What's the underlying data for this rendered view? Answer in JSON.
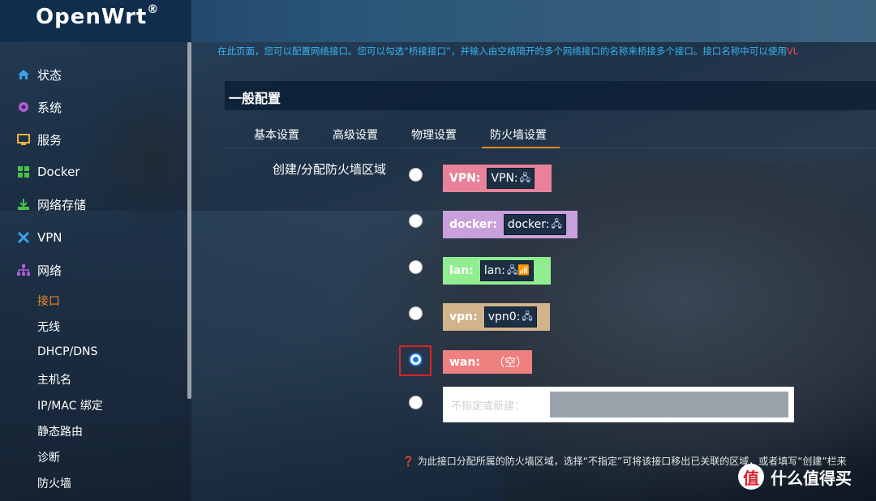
{
  "app": {
    "brand": "OpenWrt",
    "brand_mark": "®"
  },
  "sidebar": {
    "items": [
      {
        "label": "状态",
        "icon": "home-icon",
        "color": "#3aa0e8"
      },
      {
        "label": "系统",
        "icon": "gear-icon",
        "color": "#b25ad8"
      },
      {
        "label": "服务",
        "icon": "services-icon",
        "color": "#e8b43a"
      },
      {
        "label": "Docker",
        "icon": "docker-icon",
        "color": "#4cc04c"
      },
      {
        "label": "网络存储",
        "icon": "storage-icon",
        "color": "#4cc04c"
      },
      {
        "label": "VPN",
        "icon": "vpn-icon",
        "color": "#3aa0e8"
      },
      {
        "label": "网络",
        "icon": "network-icon",
        "color": "#b25ad8"
      }
    ],
    "sub_items": [
      "接口",
      "无线",
      "DHCP/DNS",
      "主机名",
      "IP/MAC 绑定",
      "静态路由",
      "诊断",
      "防火墙"
    ],
    "active_sub": "接口"
  },
  "main": {
    "hint": "在此页面，您可以配置网络接口。您可以勾选“桥接接口”，并输入由空格隔开的多个网络接口的名称来桥接多个接口。接口名称中可以使用",
    "hint_tail": "VL",
    "panel_title": "一般配置",
    "tabs": [
      "基本设置",
      "高级设置",
      "物理设置",
      "防火墙设置"
    ],
    "active_tab": "防火墙设置",
    "field_label": "创建/分配防火墙区域",
    "zones": [
      {
        "name": "VPN:",
        "iface": "VPN:",
        "icons": "🖧",
        "color": "#e8829a",
        "checked": false
      },
      {
        "name": "docker:",
        "iface": "docker:",
        "icons": "🖧",
        "color": "#c9a0dc",
        "checked": false
      },
      {
        "name": "lan:",
        "iface": "lan:",
        "icons": "🖧📶",
        "color": "#90ee90",
        "checked": false
      },
      {
        "name": "vpn:",
        "iface": "vpn0:",
        "icons": "🖧",
        "color": "#d2b48c",
        "checked": false
      },
      {
        "name": "wan:",
        "empty": "（空）",
        "color": "#f08080",
        "checked": true
      }
    ],
    "new_zone_label": "不指定或新建：",
    "help": "❓ 为此接口分配所属的防火墙区域，选择“不指定”可将该接口移出已关联的区域，或者填写“创建”栏来"
  },
  "watermark": {
    "logo": "值",
    "text": "什么值得买"
  }
}
